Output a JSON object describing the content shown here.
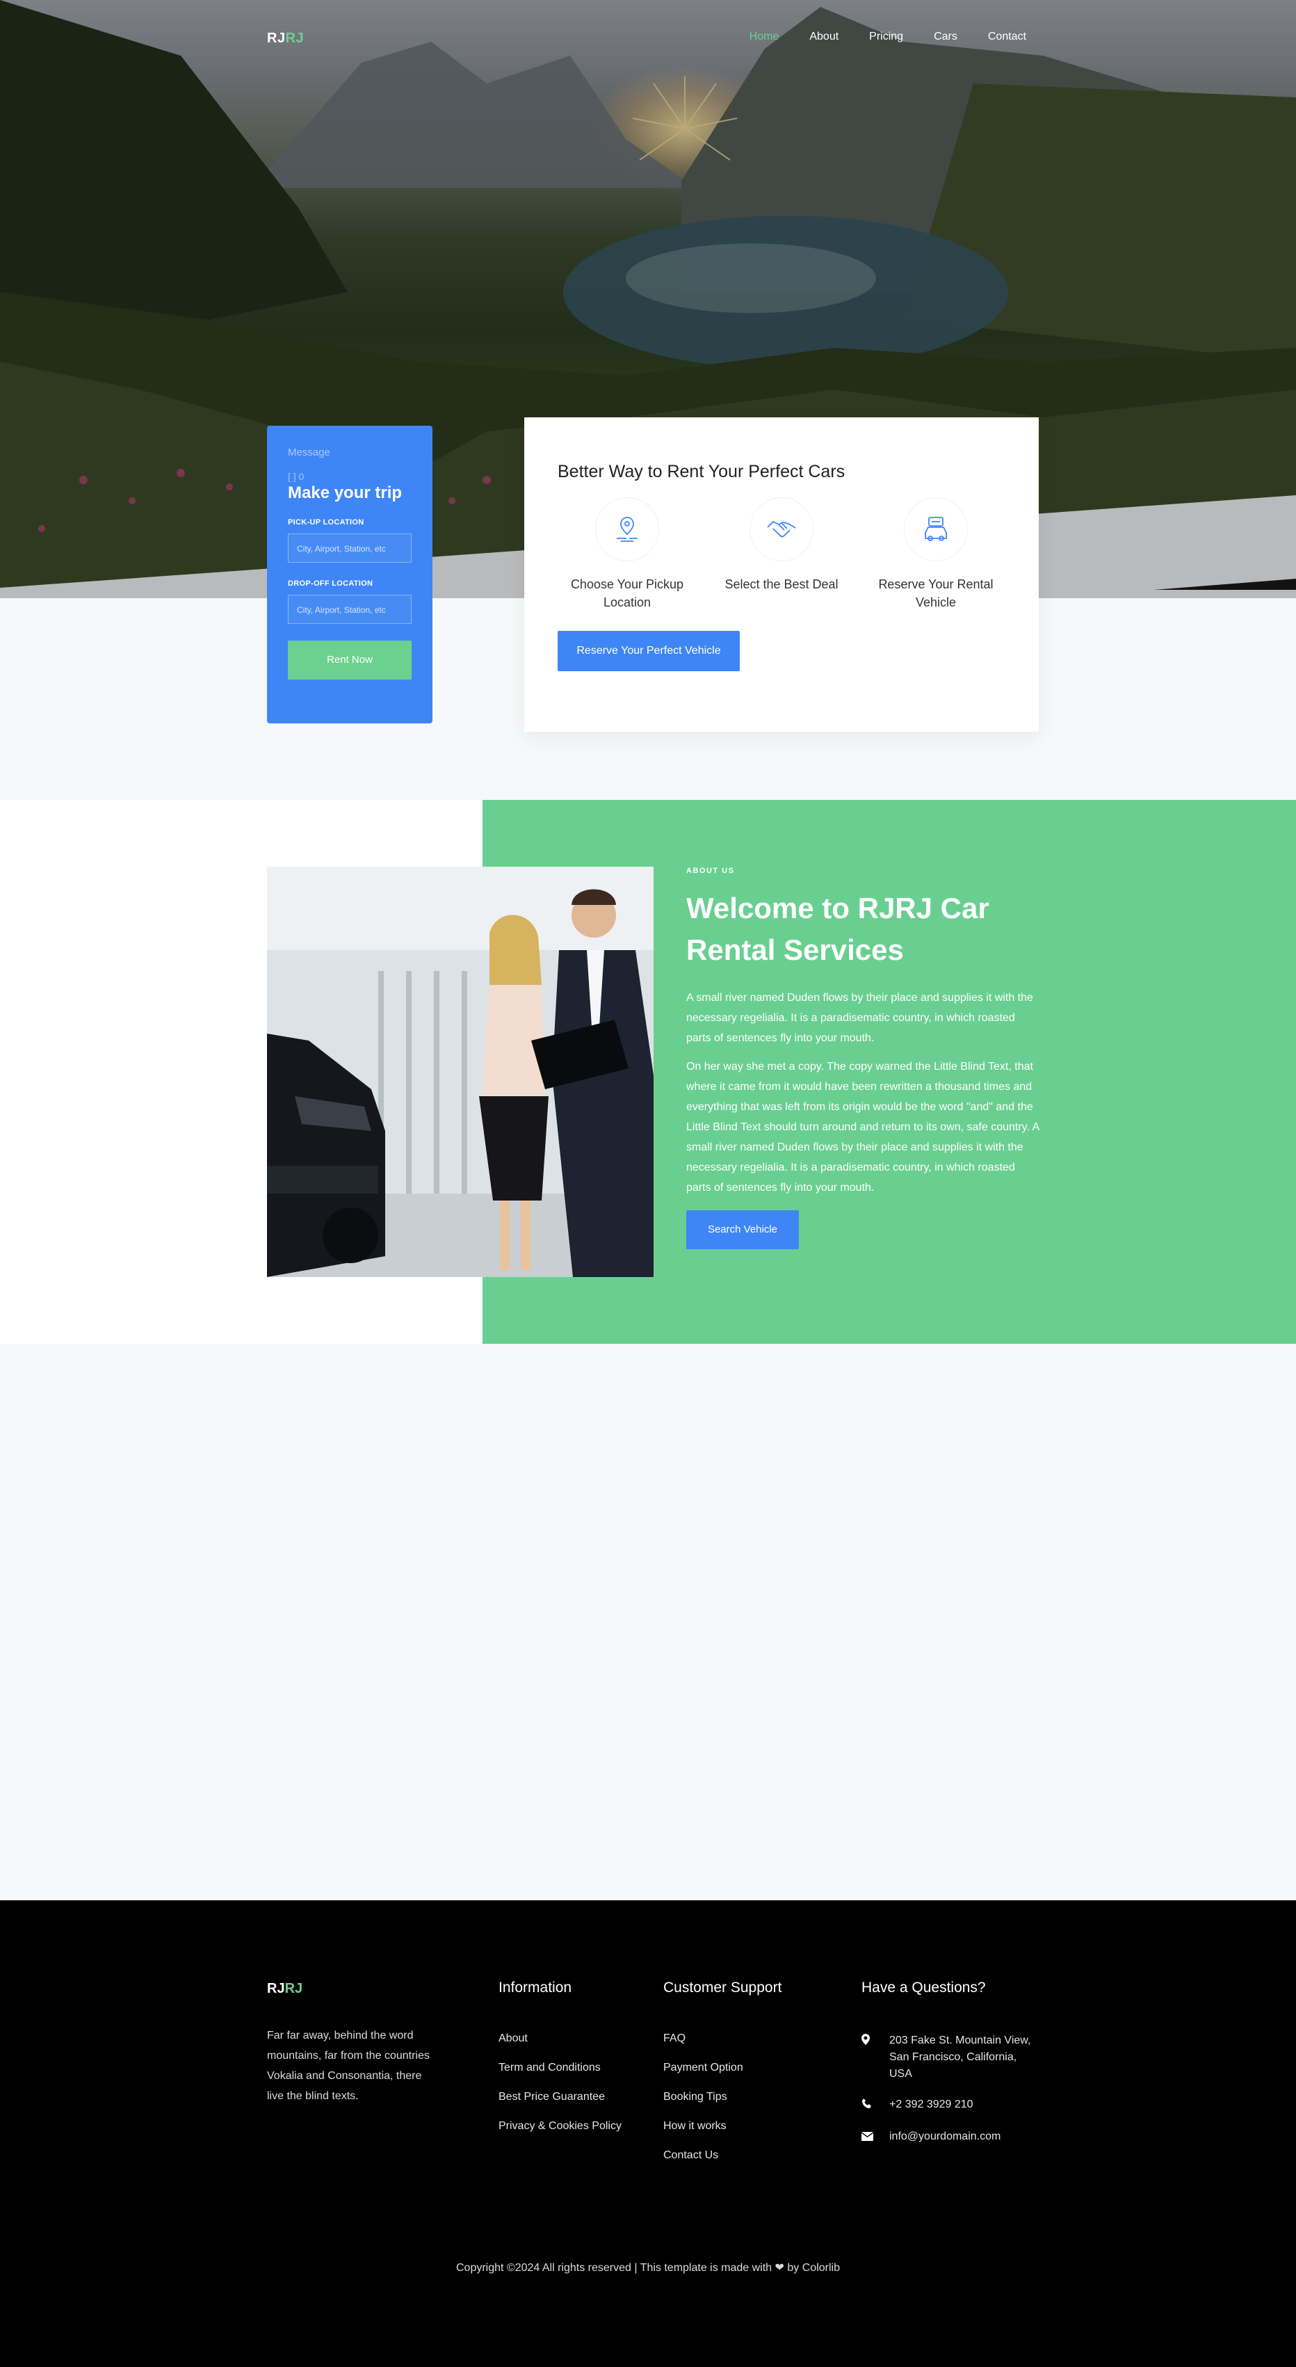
{
  "nav": {
    "logo_part1": "RJ",
    "logo_part2": "RJ",
    "links": [
      "Home",
      "About",
      "Pricing",
      "Cars",
      "Contact"
    ]
  },
  "booking": {
    "message": "Message",
    "mini": "[ ] 0",
    "title": "Make your trip",
    "pickup_label": "PICK-UP LOCATION",
    "pickup_placeholder": "City, Airport, Station, etc",
    "dropoff_label": "DROP-OFF LOCATION",
    "dropoff_placeholder": "City, Airport, Station, etc",
    "button": "Rent Now"
  },
  "service": {
    "title": "Better Way to Rent Your Perfect Cars",
    "items": [
      {
        "label": "Choose Your Pickup Location",
        "icon": "map-pin-route-icon"
      },
      {
        "label": "Select the Best Deal",
        "icon": "handshake-icon"
      },
      {
        "label": "Reserve Your Rental Vehicle",
        "icon": "car-reservation-icon"
      }
    ],
    "button": "Reserve Your Perfect Vehicle"
  },
  "about": {
    "kicker": "ABOUT US",
    "title": "Welcome to RJRJ Car Rental Services",
    "para1": "A small river named Duden flows by their place and supplies it with the necessary regelialia. It is a paradisematic country, in which roasted parts of sentences fly into your mouth.",
    "para2": "On her way she met a copy. The copy warned the Little Blind Text, that where it came from it would have been rewritten a thousand times and everything that was left from its origin would be the word \"and\" and the Little Blind Text should turn around and return to its own, safe country. A small river named Duden flows by their place and supplies it with the necessary regelialia. It is a paradisematic country, in which roasted parts of sentences fly into your mouth.",
    "button": "Search Vehicle"
  },
  "footer": {
    "logo_part1": "RJ",
    "logo_part2": "RJ",
    "description": "Far far away, behind the word mountains, far from the countries Vokalia and Consonantia, there live the blind texts.",
    "info_title": "Information",
    "info_links": [
      "About",
      "Term and Conditions",
      "Best Price Guarantee",
      "Privacy & Cookies Policy"
    ],
    "support_title": "Customer Support",
    "support_links": [
      "FAQ",
      "Payment Option",
      "Booking Tips",
      "How it works",
      "Contact Us"
    ],
    "contact_title": "Have a Questions?",
    "address": "203 Fake St. Mountain View, San Francisco, California, USA",
    "phone": "+2 392 3929 210",
    "email": "info@yourdomain.com",
    "copyright_pre": "Copyright ©2024 All rights reserved | This template is made with",
    "copyright_post": "by Colorlib"
  },
  "colors": {
    "accent_blue": "#3e86f5",
    "accent_green": "#6bd18f",
    "footer_bg": "#000000"
  }
}
